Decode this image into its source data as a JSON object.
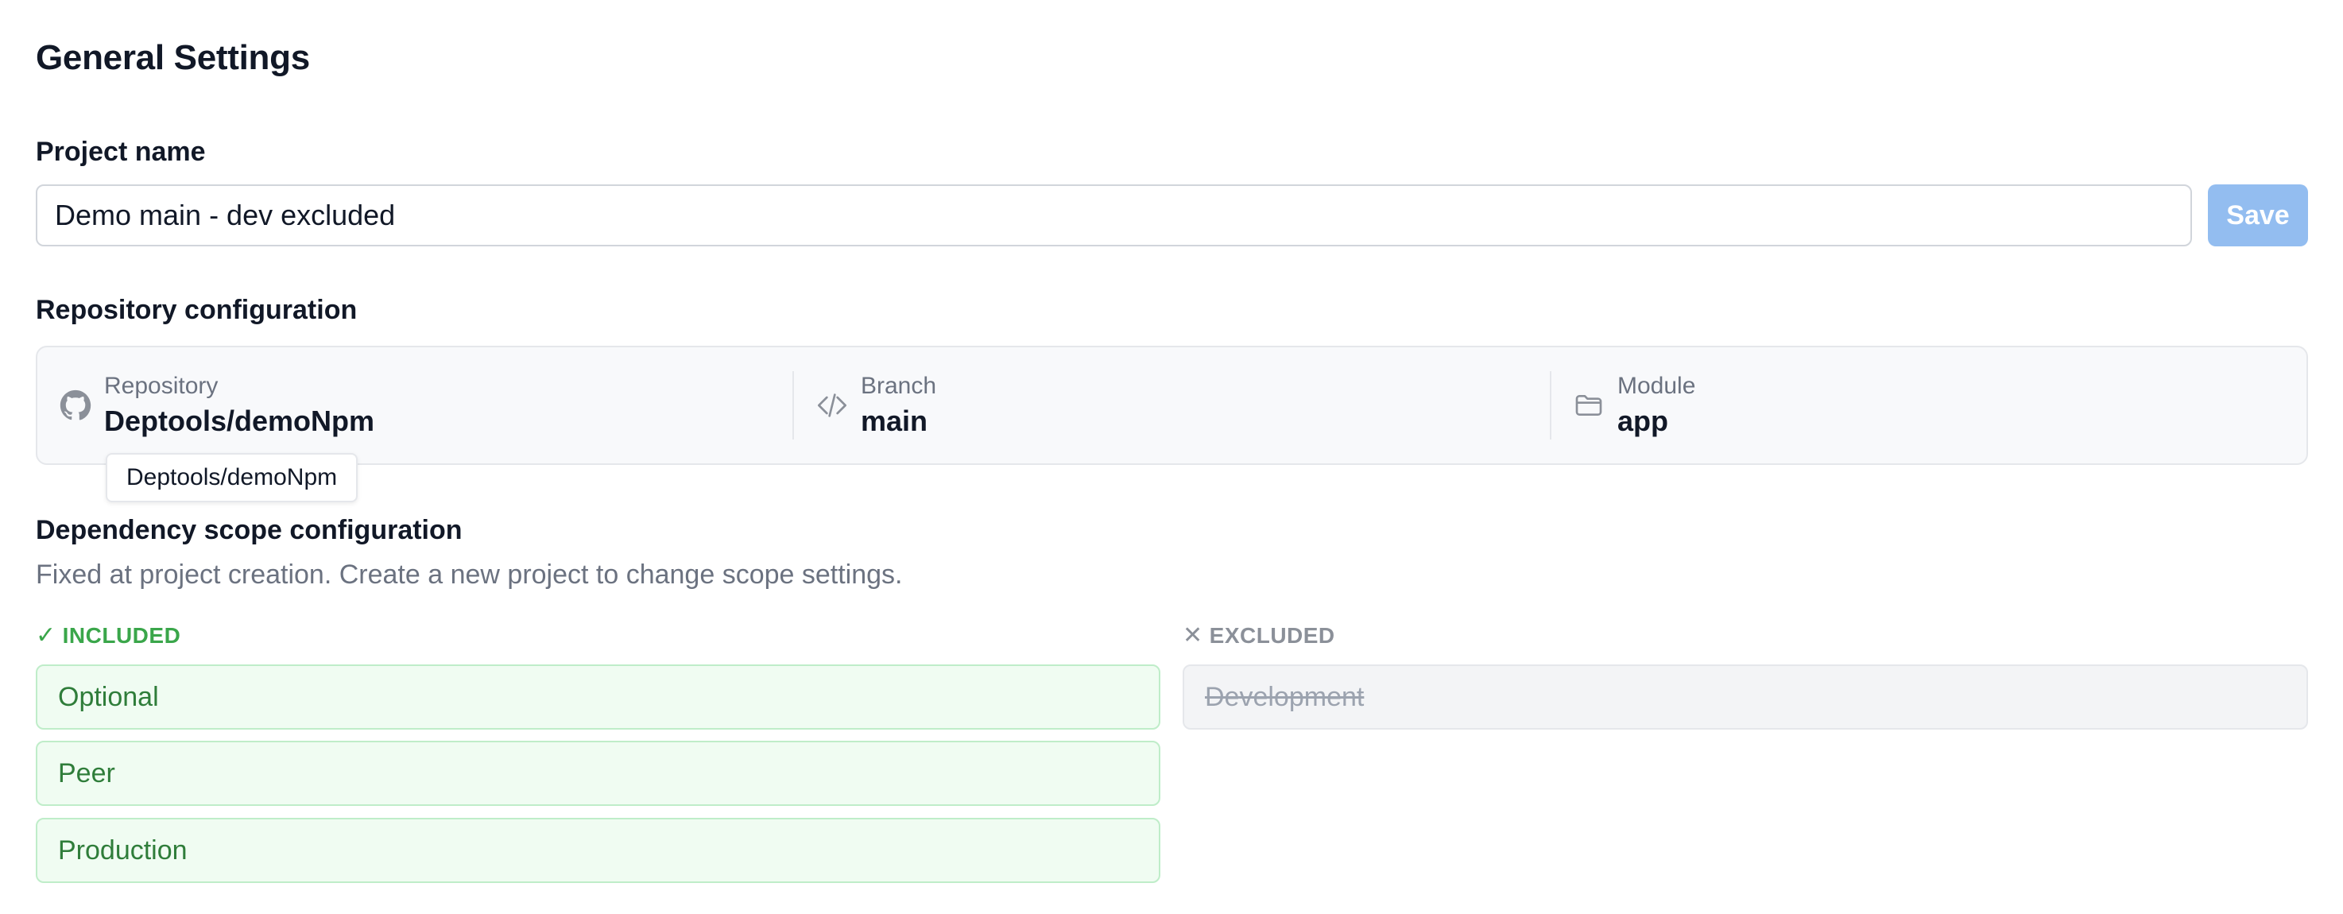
{
  "page": {
    "title": "General Settings"
  },
  "project": {
    "label": "Project name",
    "value": "Demo main - dev excluded",
    "save_label": "Save"
  },
  "repository": {
    "section_label": "Repository configuration",
    "repo_caption": "Repository",
    "repo_value": "Deptools/demoNpm",
    "repo_icon": "github-icon",
    "branch_caption": "Branch",
    "branch_value": "main",
    "branch_icon": "code-icon",
    "module_caption": "Module",
    "module_value": "app",
    "module_icon": "folder-icon",
    "tooltip": "Deptools/demoNpm"
  },
  "scope": {
    "title": "Dependency scope configuration",
    "description": "Fixed at project creation. Create a new project to change scope settings.",
    "included_mark": "✓",
    "included_label": "INCLUDED",
    "excluded_mark": "✕",
    "excluded_label": "EXCLUDED",
    "included": [
      "Optional",
      "Peer",
      "Production"
    ],
    "excluded": [
      "Development"
    ]
  },
  "colors": {
    "save_button": "#93bdf0",
    "included_text": "#2f7d3a",
    "included_bg": "#f0fcf2",
    "included_border": "#bfedc9",
    "included_heading": "#3aa64a",
    "excluded_bg": "#f3f4f6",
    "excluded_text": "#9ca3af"
  }
}
